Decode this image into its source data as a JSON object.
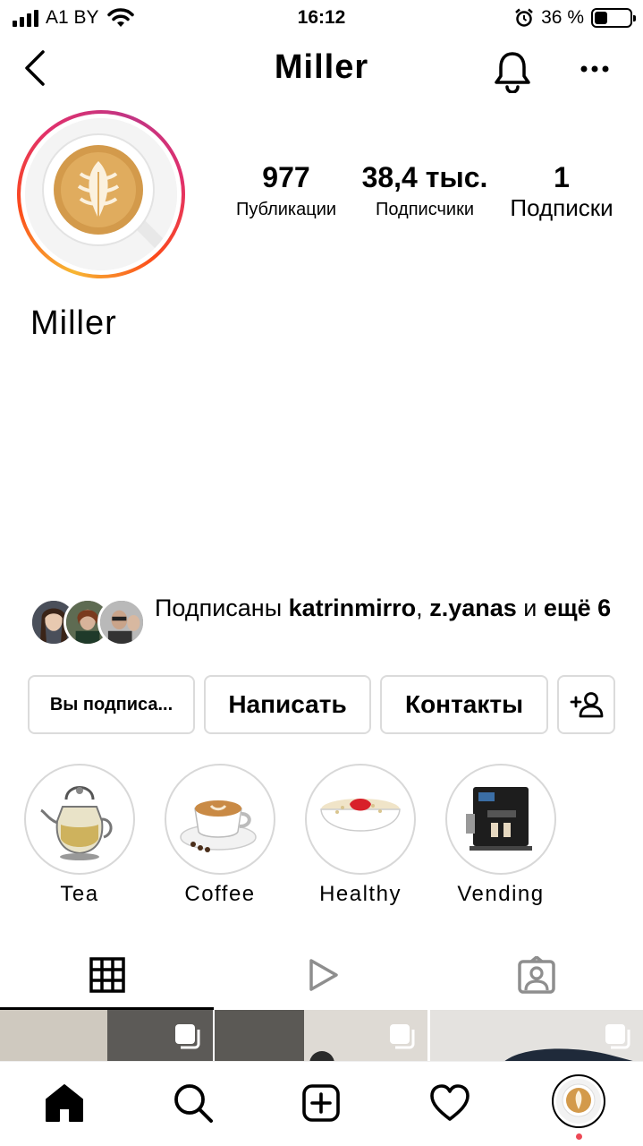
{
  "status_bar": {
    "carrier": "A1 BY",
    "time": "16:12",
    "battery_percent": "36 %",
    "battery_level": 0.36
  },
  "header": {
    "title": "Miller",
    "back_icon": "chevron-left-icon",
    "bell_icon": "bell-icon",
    "more_icon": "more-horizontal-icon"
  },
  "profile": {
    "name": "Miller",
    "stats": [
      {
        "value": "977",
        "label": "Публикации"
      },
      {
        "value": "38,4 тыс.",
        "label": "Подписчики"
      },
      {
        "value": "1",
        "label": "Подписки"
      }
    ]
  },
  "followed_by": {
    "prefix": "Подписаны ",
    "user1": "katrinmirro",
    "separator": ", ",
    "user2": "z.yanas",
    "conjunction": " и ",
    "more": "ещё 6"
  },
  "actions": {
    "following": "Вы подписа...",
    "message": "Написать",
    "contacts": "Контакты",
    "add_user_icon": "add-user-icon"
  },
  "highlights": [
    {
      "label": "Tea"
    },
    {
      "label": "Coffee"
    },
    {
      "label": "Healthy"
    },
    {
      "label": "Vending"
    }
  ],
  "tabs": {
    "grid_icon": "grid-icon",
    "reels_icon": "play-icon",
    "tagged_icon": "tagged-person-icon",
    "active": "grid"
  },
  "bottom_nav": {
    "home_icon": "home-icon",
    "search_icon": "search-icon",
    "create_icon": "plus-square-icon",
    "activity_icon": "heart-icon",
    "profile_icon": "profile-avatar"
  },
  "colors": {
    "accent_gradient_start": "#f7b733",
    "accent_gradient_mid": "#e1306c",
    "notification_dot": "#ed4956",
    "border": "#dbdbdb"
  }
}
